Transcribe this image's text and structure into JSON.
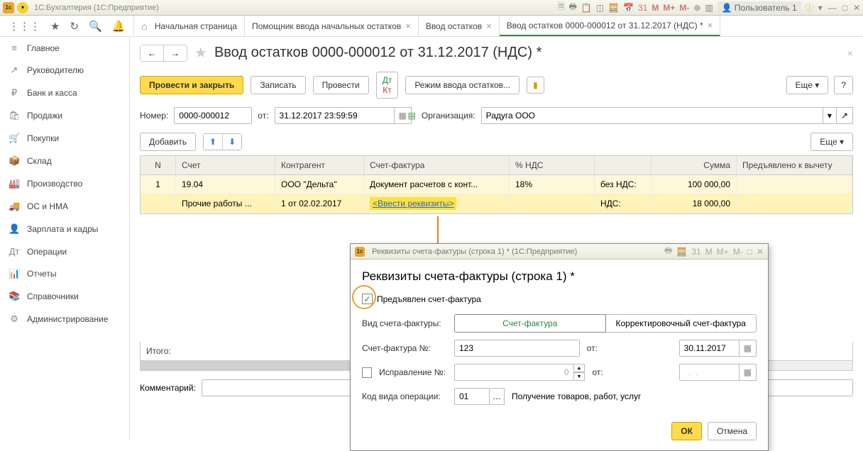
{
  "titlebar": {
    "app_title": "1С:Бухгалтерия  (1С:Предприятие)",
    "m_labels": [
      "M",
      "M+",
      "M-"
    ],
    "user_label": "Пользователь 1"
  },
  "tabs": {
    "home": "Начальная страница",
    "t1": "Помощник ввода начальных остатков",
    "t2": "Ввод остатков",
    "t3": "Ввод остатков 0000-000012 от 31.12.2017 (НДС) *"
  },
  "sidebar": {
    "items": [
      {
        "icon": "≡",
        "label": "Главное"
      },
      {
        "icon": "↗",
        "label": "Руководителю"
      },
      {
        "icon": "₽",
        "label": "Банк и касса"
      },
      {
        "icon": "🛍",
        "label": "Продажи"
      },
      {
        "icon": "🛒",
        "label": "Покупки"
      },
      {
        "icon": "📦",
        "label": "Склад"
      },
      {
        "icon": "🏭",
        "label": "Производство"
      },
      {
        "icon": "🚚",
        "label": "ОС и НМА"
      },
      {
        "icon": "👤",
        "label": "Зарплата и кадры"
      },
      {
        "icon": "Дт",
        "label": "Операции"
      },
      {
        "icon": "📊",
        "label": "Отчеты"
      },
      {
        "icon": "📚",
        "label": "Справочники"
      },
      {
        "icon": "⚙",
        "label": "Администрирование"
      }
    ]
  },
  "doc": {
    "title": "Ввод остатков 0000-000012 от 31.12.2017 (НДС) *",
    "btn_post_close": "Провести и закрыть",
    "btn_save": "Записать",
    "btn_post": "Провести",
    "btn_mode": "Режим ввода остатков...",
    "btn_more": "Еще",
    "lbl_number": "Номер:",
    "number": "0000-000012",
    "lbl_from": "от:",
    "date": "31.12.2017 23:59:59",
    "lbl_org": "Организация:",
    "org": "Радуга ООО",
    "btn_add": "Добавить",
    "btn_more2": "Еще",
    "lbl_total": "Итого:",
    "lbl_comment": "Комментарий:",
    "comment": ""
  },
  "table": {
    "head": {
      "n": "N",
      "acc": "Счет",
      "ctr": "Контрагент",
      "sf": "Счет-фактура",
      "vat": "% НДС",
      "lbl": "",
      "sum": "Сумма",
      "ded": "Предъявлено к вычету"
    },
    "r1": {
      "n": "1",
      "acc": "19.04",
      "ctr": "ООО \"Дельта\"",
      "sf": "Документ расчетов с конт...",
      "vat": "18%",
      "lbl": "без НДС:",
      "sum": "100 000,00",
      "ded": ""
    },
    "r2": {
      "acc": "Прочие работы ...",
      "ctr": "1 от 02.02.2017",
      "sf": "<Ввести реквизиты>",
      "lbl": "НДС:",
      "sum": "18 000,00",
      "ded": ""
    }
  },
  "dlg": {
    "tb_title": "Реквизиты счета-фактуры (строка 1) *  (1С:Предприятие)",
    "heading": "Реквизиты счета-фактуры (строка 1) *",
    "chk_label": "Предъявлен счет-фактура",
    "lbl_type": "Вид счета-фактуры:",
    "seg_invoice": "Счет-фактура",
    "seg_corr": "Корректировочный счет-фактура",
    "lbl_num": "Счет-фактура №:",
    "num": "123",
    "lbl_from": "от:",
    "date": "30.11.2017",
    "lbl_fix": "Исправление №:",
    "fix_num": "0",
    "lbl_fix_from": "от:",
    "fix_date": "  .  .    ",
    "lbl_op": "Код вида операции:",
    "op_code": "01",
    "op_desc": "Получение товаров, работ, услуг",
    "btn_ok": "ОК",
    "btn_cancel": "Отмена",
    "m_labels": [
      "M",
      "M+",
      "M-"
    ]
  }
}
